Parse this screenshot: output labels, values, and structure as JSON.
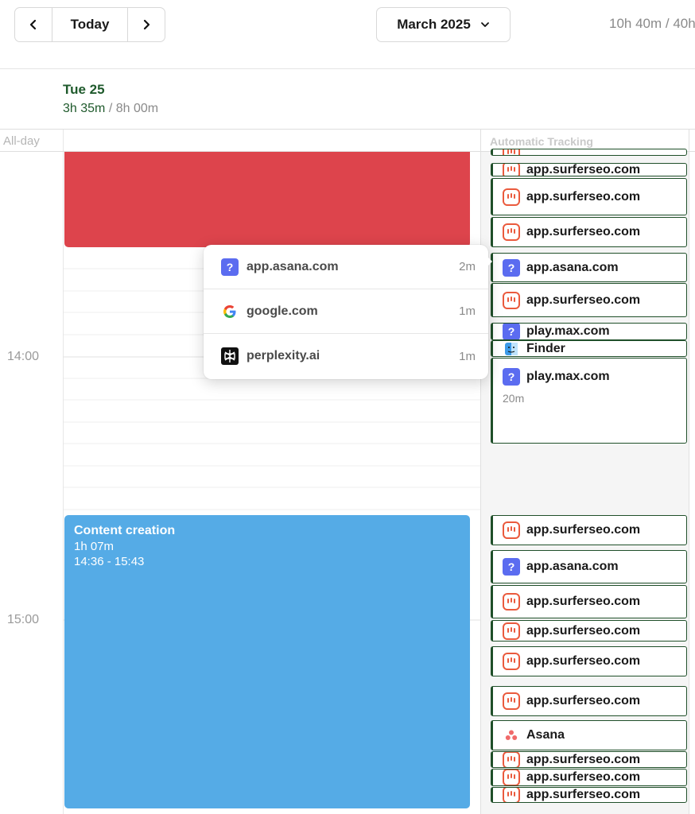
{
  "toolbar": {
    "today_label": "Today",
    "month_label": "March 2025",
    "total_time": "10h 40m / 40h"
  },
  "day": {
    "label": "Tue 25",
    "tracked": "3h 35m",
    "separator": " / ",
    "goal": "8h 00m"
  },
  "allday_label": "All-day",
  "automatic_tracking_label": "Automatic Tracking",
  "hours": [
    "14:00",
    "15:00"
  ],
  "events": {
    "content_creation": {
      "title": "Content creation",
      "duration": "1h 07m",
      "time_range": "14:36 - 15:43",
      "color": "#55abe6"
    },
    "red_block": {
      "color": "#dd444c"
    }
  },
  "popover": {
    "items": [
      {
        "name": "app.asana.com",
        "duration": "2m",
        "icon": "question-icon"
      },
      {
        "name": "google.com",
        "duration": "1m",
        "icon": "google-icon"
      },
      {
        "name": "perplexity.ai",
        "duration": "1m",
        "icon": "perplexity-icon"
      }
    ]
  },
  "tracking": [
    {
      "name": "",
      "icon": "surferseo-icon"
    },
    {
      "name": "app.surferseo.com",
      "icon": "surferseo-icon"
    },
    {
      "name": "app.surferseo.com",
      "icon": "surferseo-icon"
    },
    {
      "name": "app.surferseo.com",
      "icon": "surferseo-icon"
    },
    {
      "name": "app.asana.com",
      "icon": "question-icon"
    },
    {
      "name": "app.surferseo.com",
      "icon": "surferseo-icon"
    },
    {
      "name": "play.max.com",
      "icon": "question-icon"
    },
    {
      "name": "Finder",
      "icon": "finder-icon"
    },
    {
      "name": "play.max.com",
      "duration": "20m",
      "icon": "question-icon"
    },
    {
      "name": "app.surferseo.com",
      "icon": "surferseo-icon"
    },
    {
      "name": "app.asana.com",
      "icon": "question-icon"
    },
    {
      "name": "app.surferseo.com",
      "icon": "surferseo-icon"
    },
    {
      "name": "app.surferseo.com",
      "icon": "surferseo-icon"
    },
    {
      "name": "app.surferseo.com",
      "icon": "surferseo-icon"
    },
    {
      "name": "app.surferseo.com",
      "icon": "surferseo-icon"
    },
    {
      "name": "Asana",
      "icon": "asana-icon"
    },
    {
      "name": "app.surferseo.com",
      "icon": "surferseo-icon"
    },
    {
      "name": "app.surferseo.com",
      "icon": "surferseo-icon"
    },
    {
      "name": "app.surferseo.com",
      "icon": "surferseo-icon"
    }
  ],
  "colors": {
    "accent_green": "#1f5a2c",
    "card_border": "#1f4f29",
    "surfer_orange": "#ea5a3d",
    "question_blue": "#5b6cf0"
  }
}
